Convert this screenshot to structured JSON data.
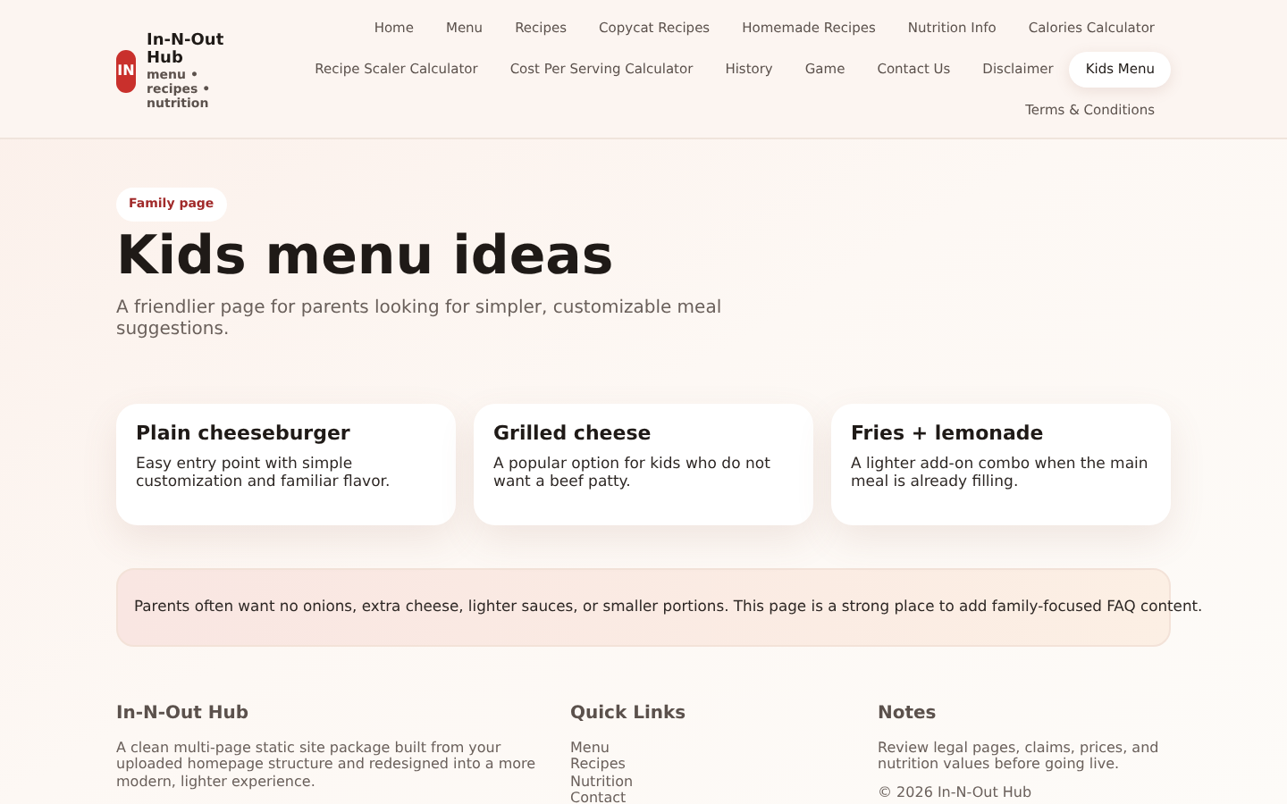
{
  "brand": {
    "logo": "IN",
    "name": "In-N-Out Hub",
    "tagline": "menu • recipes • nutrition"
  },
  "nav": [
    {
      "label": "Home",
      "selected": false
    },
    {
      "label": "Menu",
      "selected": false
    },
    {
      "label": "Recipes",
      "selected": false
    },
    {
      "label": "Copycat Recipes",
      "selected": false
    },
    {
      "label": "Homemade Recipes",
      "selected": false
    },
    {
      "label": "Nutrition Info",
      "selected": false
    },
    {
      "label": "Calories Calculator",
      "selected": false
    },
    {
      "label": "Recipe Scaler Calculator",
      "selected": false
    },
    {
      "label": "Cost Per Serving Calculator",
      "selected": false
    },
    {
      "label": "History",
      "selected": false
    },
    {
      "label": "Game",
      "selected": false
    },
    {
      "label": "Contact Us",
      "selected": false
    },
    {
      "label": "Disclaimer",
      "selected": false
    },
    {
      "label": "Kids Menu",
      "selected": true
    },
    {
      "label": "Terms & Conditions",
      "selected": false
    }
  ],
  "hero": {
    "badge": "Family page",
    "title": "Kids menu ideas",
    "subtitle": "A friendlier page for parents looking for simpler, customizable meal suggestions."
  },
  "cards": [
    {
      "title": "Plain cheeseburger",
      "text": "Easy entry point with simple customization and familiar flavor."
    },
    {
      "title": "Grilled cheese",
      "text": "A popular option for kids who do not want a beef patty."
    },
    {
      "title": "Fries + lemonade",
      "text": "A lighter add-on combo when the main meal is already filling."
    }
  ],
  "note": "Parents often want no onions, extra cheese, lighter sauces, or smaller portions. This page is a strong place to add family-focused FAQ content.",
  "footer": {
    "about": {
      "title": "In-N-Out Hub",
      "text": "A clean multi-page static site package built from your uploaded homepage structure and redesigned into a more modern, lighter experience."
    },
    "links": {
      "title": "Quick Links",
      "items": [
        "Menu",
        "Recipes",
        "Nutrition",
        "Contact"
      ]
    },
    "notes": {
      "title": "Notes",
      "text": "Review legal pages, claims, prices, and nutrition values before going live.",
      "copyright": "© 2026 In-N-Out Hub"
    }
  }
}
